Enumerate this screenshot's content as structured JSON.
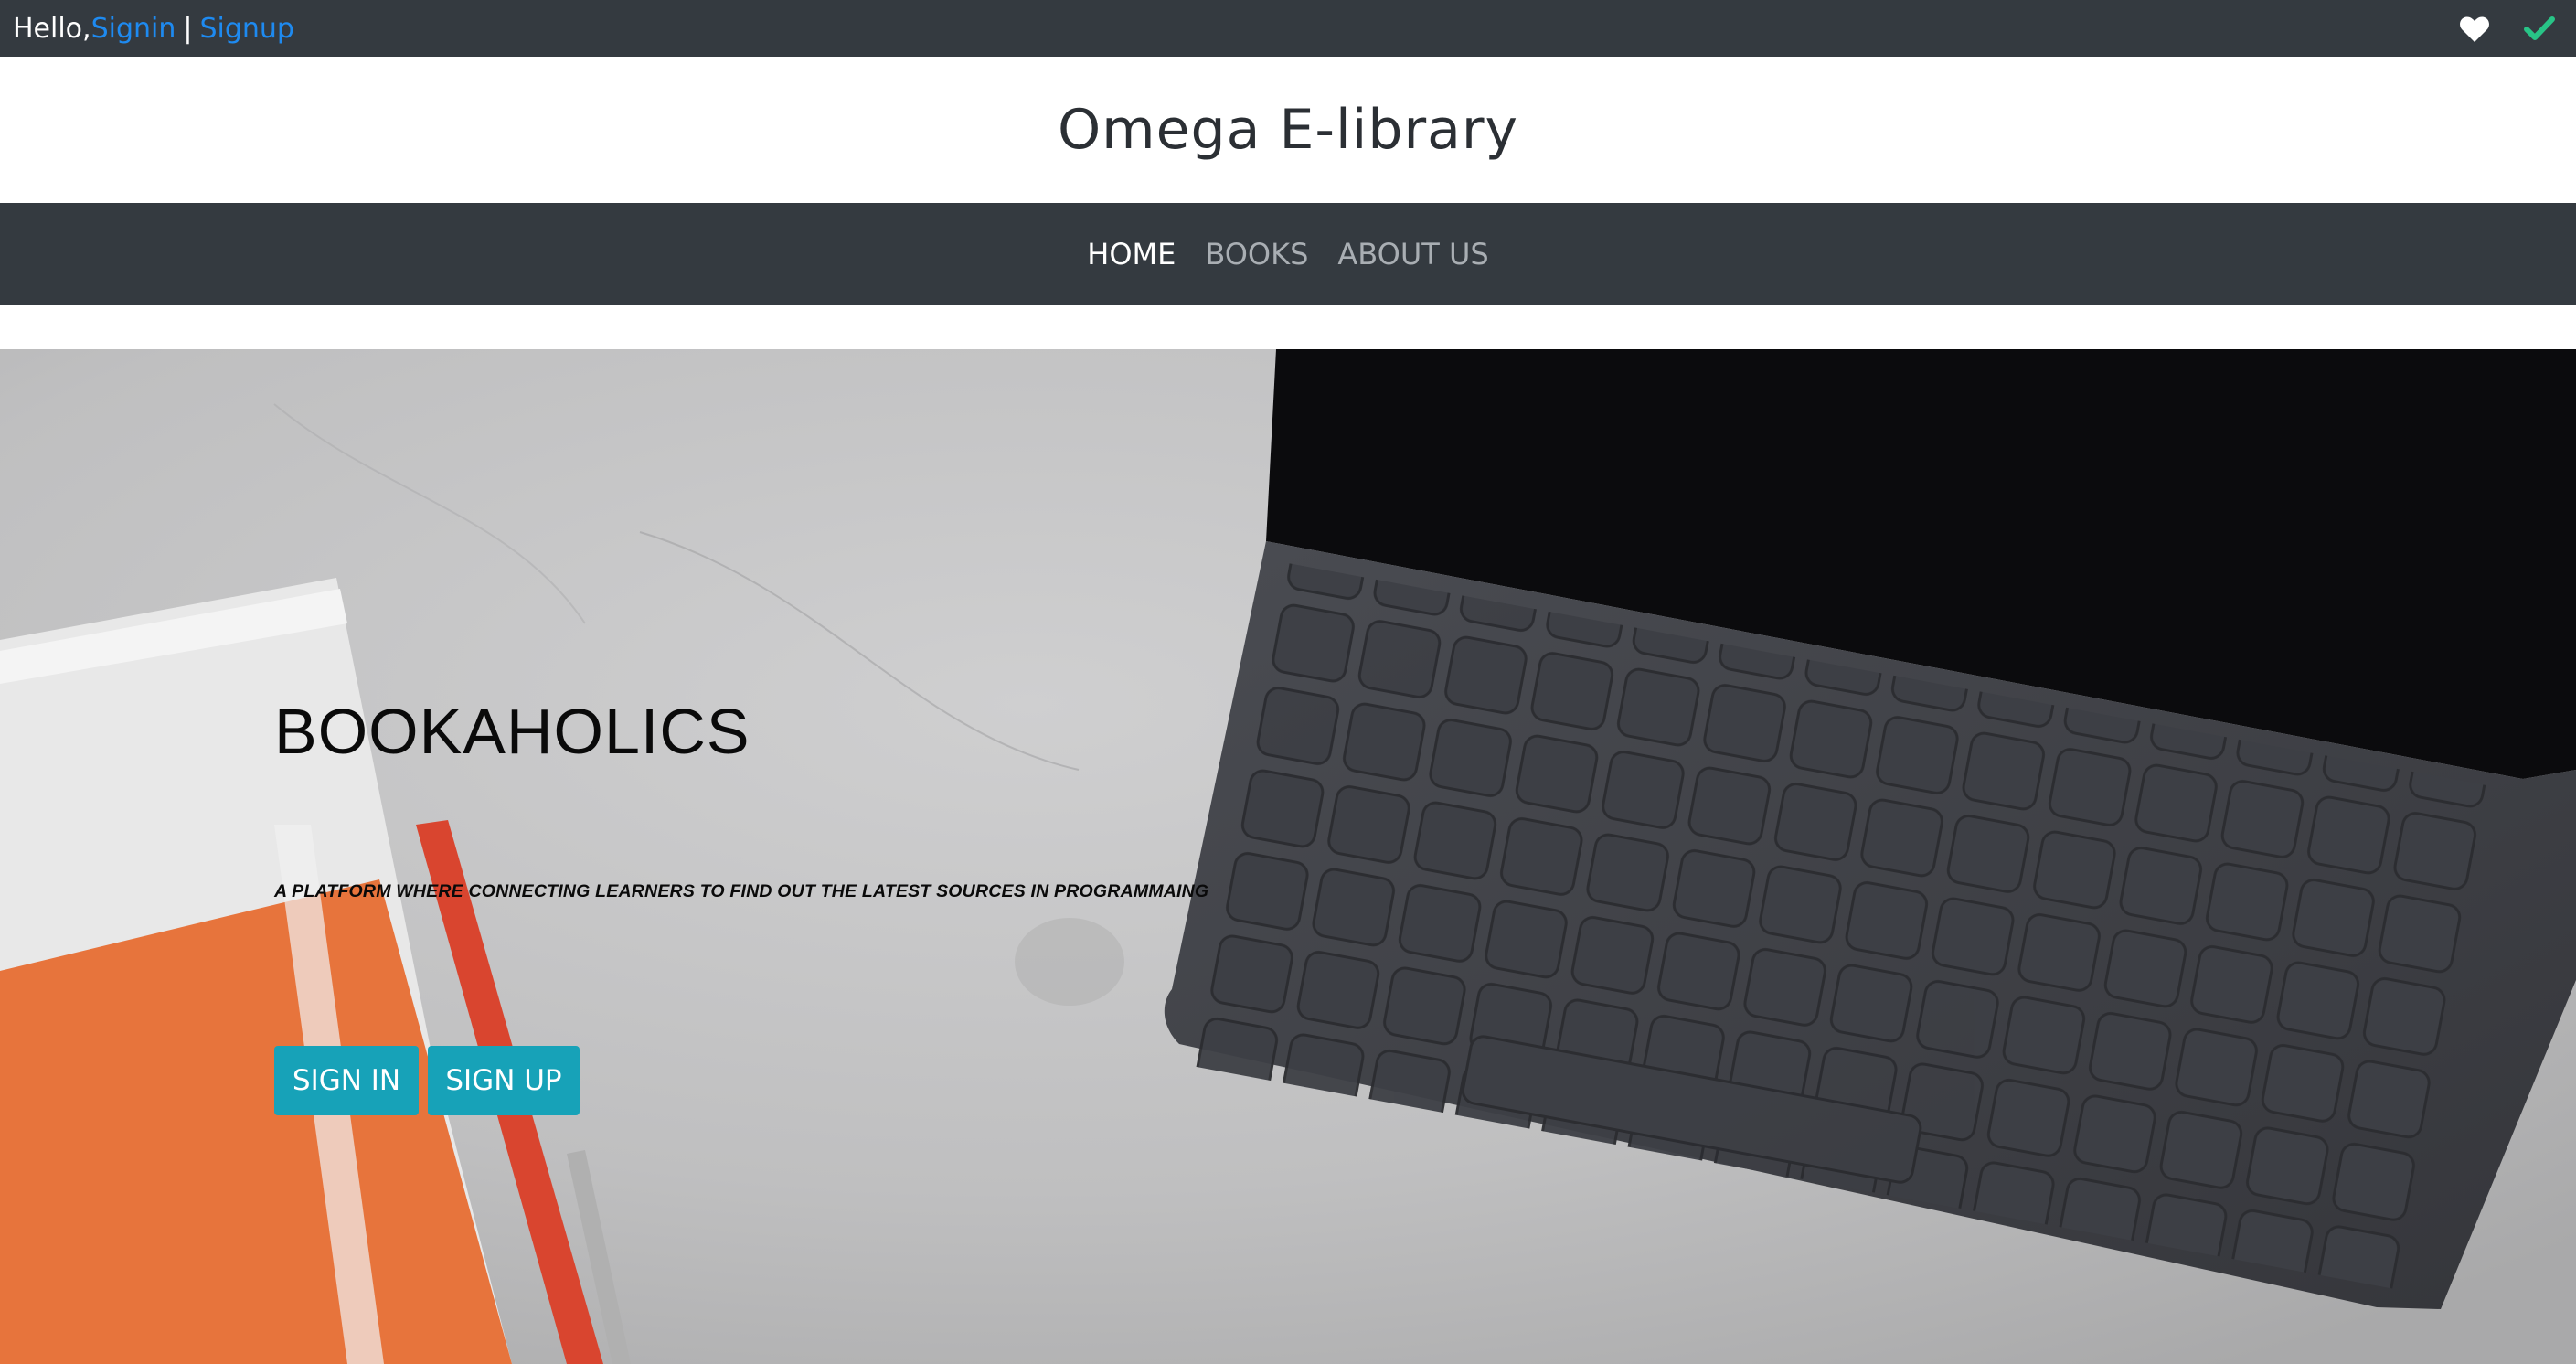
{
  "topbar": {
    "greeting": "Hello,",
    "signin_link": "Signin",
    "separator": "|",
    "signup_link": "Signup",
    "icons": [
      "heart-icon",
      "check-icon"
    ],
    "colors": {
      "background": "#343a40",
      "link": "#1e8af0",
      "check": "#28c487"
    }
  },
  "brand": {
    "title": "Omega E-library"
  },
  "nav": {
    "items": [
      {
        "label": "HOME",
        "active": true
      },
      {
        "label": "BOOKS",
        "active": false
      },
      {
        "label": "ABOUT US",
        "active": false
      }
    ]
  },
  "hero": {
    "title": "BOOKAHOLICS",
    "tagline": "A PLATFORM WHERE CONNECTING LEARNERS TO FIND OUT THE LATEST SOURCES IN PROGRAMMAING",
    "signin_button": "SIGN IN",
    "signup_button": "SIGN UP",
    "colors": {
      "button": "#17a2b8"
    }
  }
}
